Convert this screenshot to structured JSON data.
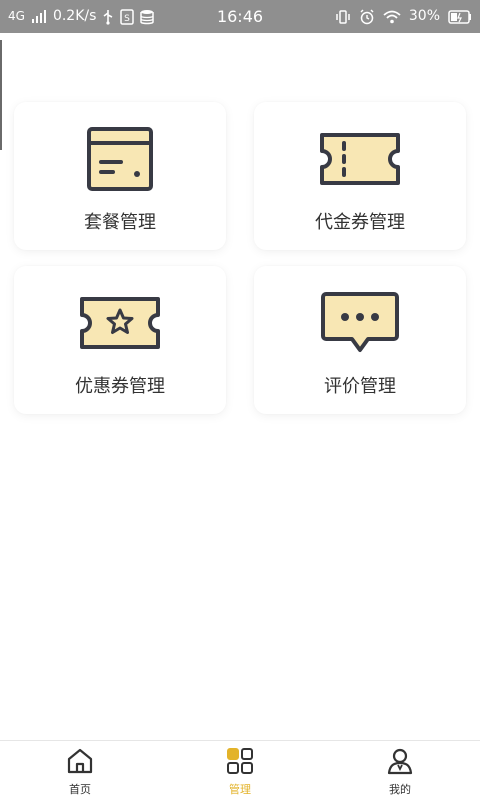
{
  "status_bar": {
    "network": "4G",
    "speed": "0.2K/s",
    "time": "16:46",
    "battery": "30%"
  },
  "cards": [
    {
      "label": "套餐管理",
      "icon": "package-icon"
    },
    {
      "label": "代金券管理",
      "icon": "voucher-icon"
    },
    {
      "label": "优惠券管理",
      "icon": "coupon-icon"
    },
    {
      "label": "评价管理",
      "icon": "comment-icon"
    }
  ],
  "bottom_nav": {
    "items": [
      {
        "label": "首页",
        "icon": "home-icon"
      },
      {
        "label": "管理",
        "icon": "grid-icon",
        "active": true
      },
      {
        "label": "我的",
        "icon": "user-icon"
      }
    ]
  },
  "colors": {
    "accent": "#e3b32a",
    "icon_fill": "#f8e7b4",
    "icon_stroke": "#383a44"
  }
}
